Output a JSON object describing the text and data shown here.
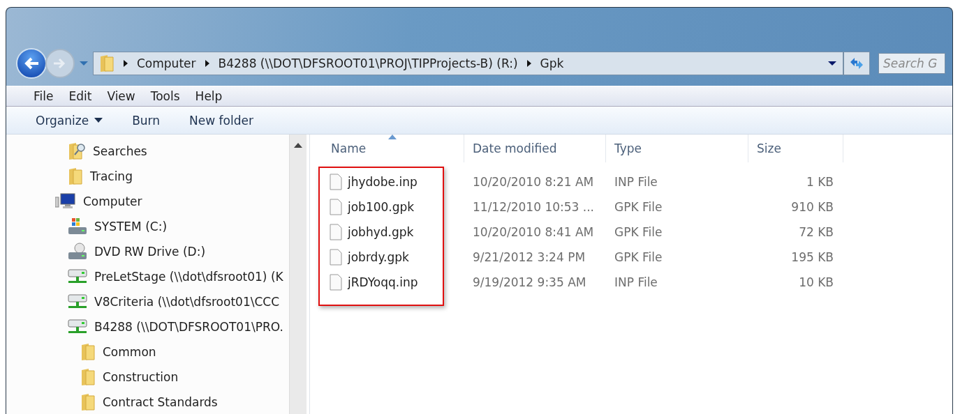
{
  "address_bar": {
    "crumbs": [
      "Computer",
      "B4288 (\\\\DOT\\DFSROOT01\\PROJ\\TIPProjects-B) (R:)",
      "Gpk"
    ]
  },
  "search": {
    "placeholder": "Search G"
  },
  "menu_bar": [
    "File",
    "Edit",
    "View",
    "Tools",
    "Help"
  ],
  "toolbar": [
    {
      "label": "Organize",
      "dropdown": true
    },
    {
      "label": "Burn",
      "dropdown": false
    },
    {
      "label": "New folder",
      "dropdown": false
    }
  ],
  "sidebar": {
    "items": [
      {
        "label": "Searches",
        "kind": "search"
      },
      {
        "label": "Tracing",
        "kind": "folder"
      },
      {
        "label": "Computer",
        "kind": "computer",
        "children": [
          {
            "label": "SYSTEM (C:)",
            "kind": "drive"
          },
          {
            "label": "DVD RW Drive (D:)",
            "kind": "dvd"
          },
          {
            "label": "PreLetStage (\\\\dot\\dfsroot01) (K",
            "kind": "network"
          },
          {
            "label": "V8Criteria (\\\\dot\\dfsroot01\\CCC",
            "kind": "network"
          },
          {
            "label": "B4288 (\\\\DOT\\DFSROOT01\\PRO.",
            "kind": "network",
            "children": [
              {
                "label": "Common",
                "kind": "folder"
              },
              {
                "label": "Construction",
                "kind": "folder"
              },
              {
                "label": "Contract Standards",
                "kind": "folder"
              }
            ]
          }
        ]
      }
    ]
  },
  "table": {
    "name_highlight": true,
    "columns": [
      {
        "label": "Name",
        "sorted": true
      },
      {
        "label": "Date modified",
        "sorted": false
      },
      {
        "label": "Type",
        "sorted": false
      },
      {
        "label": "Size",
        "sorted": false
      }
    ],
    "rows": [
      {
        "name": "jhydobe.inp",
        "date": "10/20/2010 8:21 AM",
        "type": "INP File",
        "size": "1 KB"
      },
      {
        "name": "job100.gpk",
        "date": "11/12/2010 10:53 ...",
        "type": "GPK File",
        "size": "910 KB"
      },
      {
        "name": "jobhyd.gpk",
        "date": "10/20/2010 8:41 AM",
        "type": "GPK File",
        "size": "72 KB"
      },
      {
        "name": "jobrdy.gpk",
        "date": "9/21/2012 3:24 PM",
        "type": "GPK File",
        "size": "195 KB"
      },
      {
        "name": "jRDYoqq.inp",
        "date": "9/19/2012 9:35 AM",
        "type": "INP File",
        "size": "10 KB"
      }
    ]
  }
}
